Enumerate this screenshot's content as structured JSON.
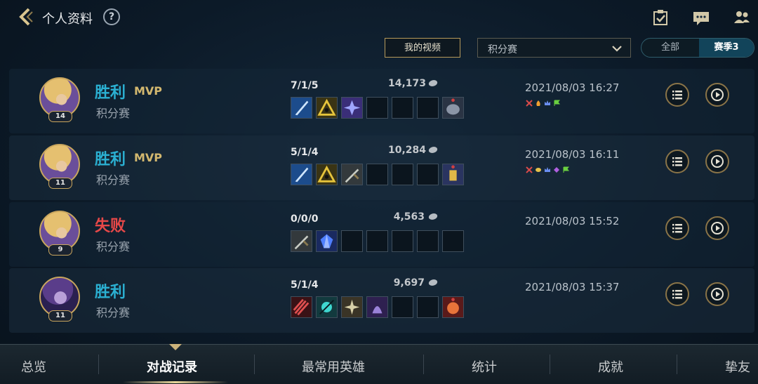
{
  "header": {
    "title": "个人资料",
    "help": "?",
    "icons": [
      "checklist-icon",
      "chat-icon",
      "friends-icon"
    ]
  },
  "filters": {
    "video_button": "我的视频",
    "mode_select": "积分赛",
    "segments": [
      "全部",
      "赛季3"
    ],
    "selected_segment": "赛季3"
  },
  "matches": [
    {
      "result": "胜利",
      "outcome": "win",
      "mvp": "MVP",
      "mode": "积分赛",
      "level": "14",
      "kda": "7/1/5",
      "gold": "14,173",
      "datetime": "2021/08/03 16:27",
      "items": [
        "blue-blade",
        "gold-triangle",
        "purple-shuriken",
        "",
        "",
        "",
        "gray-ward"
      ],
      "badges": [
        "sword-badge",
        "fire-badge",
        "crown-badge",
        "flag-badge"
      ]
    },
    {
      "result": "胜利",
      "outcome": "win",
      "mvp": "MVP",
      "mode": "积分赛",
      "level": "11",
      "kda": "5/1/4",
      "gold": "10,284",
      "datetime": "2021/08/03 16:11",
      "items": [
        "blue-blade",
        "gold-triangle",
        "long-sword",
        "",
        "",
        "",
        "gold-ward"
      ],
      "badges": [
        "sword-badge",
        "coin-badge",
        "crown-badge",
        "gem-badge",
        "flag-badge"
      ]
    },
    {
      "result": "失败",
      "outcome": "loss",
      "mvp": "",
      "mode": "积分赛",
      "level": "9",
      "kda": "0/0/0",
      "gold": "4,563",
      "datetime": "2021/08/03 15:52",
      "items": [
        "long-sword",
        "blue-crystal",
        "",
        "",
        "",
        "",
        ""
      ],
      "badges": []
    },
    {
      "result": "胜利",
      "outcome": "win",
      "mvp": "",
      "mode": "积分赛",
      "level": "11",
      "kda": "5/1/4",
      "gold": "9,697",
      "datetime": "2021/08/03 15:37",
      "items": [
        "red-claw",
        "teal-orb",
        "star-dagger",
        "purple-cloak",
        "",
        "red-ward"
      ],
      "badges": []
    }
  ],
  "nav": {
    "tabs": [
      "总览",
      "对战记录",
      "最常用英雄",
      "统计",
      "成就",
      "挚友"
    ],
    "active": "对战记录"
  },
  "colors": {
    "win": "#2bb0d2",
    "loss": "#e64848",
    "gold": "#c9a65e"
  }
}
